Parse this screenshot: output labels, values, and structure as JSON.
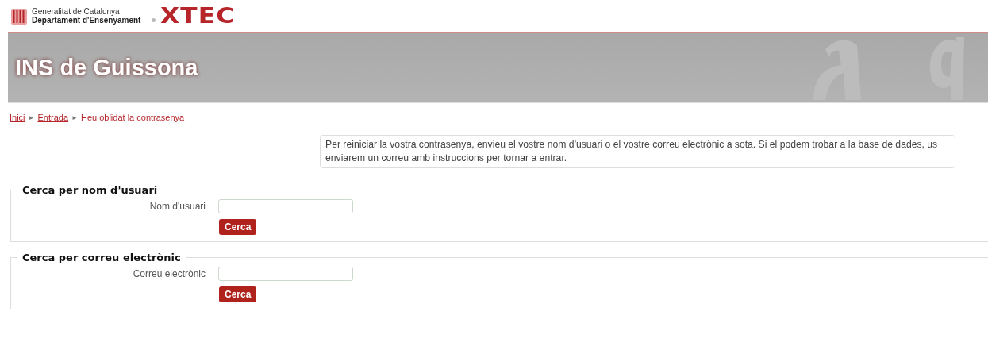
{
  "header": {
    "org_line_1": "Generalitat de Catalunya",
    "org_line_2": "Departament d'Ensenyament",
    "logo": "XTEC"
  },
  "banner": {
    "title": "INS de Guissona"
  },
  "breadcrumb": [
    {
      "label": "Inici",
      "kind": "link"
    },
    {
      "label": "Entrada",
      "kind": "link"
    },
    {
      "label": "Heu oblidat la contrasenya",
      "kind": "current"
    }
  ],
  "breadcrumb_separator": "►",
  "intro": "Per reiniciar la vostra contrasenya, envieu el vostre nom d'usuari o el vostre correu electrònic a sota. Si el podem trobar a la base de dades, us enviarem un correu amb instruccions per tornar a entrar.",
  "forms": [
    {
      "legend": "Cerca per nom d'usuari",
      "label": "Nom d'usuari",
      "button": "Cerca"
    },
    {
      "legend": "Cerca per correu electrònic",
      "label": "Correu electrònic",
      "button": "Cerca"
    }
  ]
}
